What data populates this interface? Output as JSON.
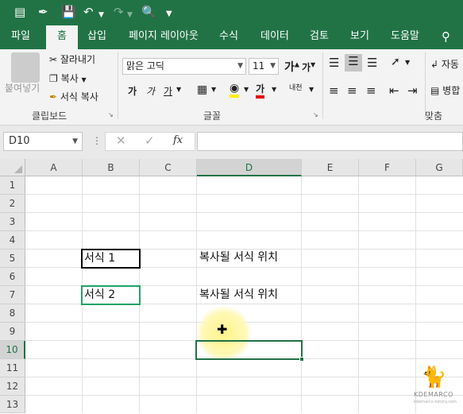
{
  "qat": {
    "icons": [
      "sheet-icon",
      "format-painter-icon",
      "save-icon",
      "undo-icon",
      "redo-icon",
      "print-preview-icon",
      "customize-icon"
    ]
  },
  "tabs": [
    "파일",
    "홈",
    "삽입",
    "페이지 레이아웃",
    "수식",
    "데이터",
    "검토",
    "보기",
    "도움말"
  ],
  "active_tab": "홈",
  "ribbon": {
    "clipboard": {
      "paste": "붙여넣기",
      "cut": "잘라내기",
      "copy": "복사",
      "format_painter": "서식 복사",
      "group_label": "클립보드"
    },
    "font": {
      "font_name": "맑은 고딕",
      "font_size": "11",
      "grow": "가",
      "shrink": "가",
      "bold": "가",
      "italic": "가",
      "underline": "가",
      "font_color": "가",
      "phonetic": "내천",
      "group_label": "글꼴"
    },
    "alignment": {
      "wrap": "자동",
      "merge": "병합",
      "group_label": "맞춤"
    }
  },
  "formula_bar": {
    "name_box": "D10",
    "fx": "fx",
    "content": ""
  },
  "grid": {
    "columns": [
      "A",
      "B",
      "C",
      "D",
      "E",
      "F",
      "G"
    ],
    "selected_column": "D",
    "rows": [
      "1",
      "2",
      "3",
      "4",
      "5",
      "6",
      "7",
      "8",
      "9",
      "10",
      "11",
      "12",
      "13"
    ],
    "selected_row": "10",
    "cells": {
      "B5": "서식 1",
      "B7": "서식 2",
      "D5": "복사될 서식 위치",
      "D7": "복사될 서식 위치"
    }
  },
  "watermark": {
    "brand": "KDEMARCO",
    "url": "kdemarco.tistory.com"
  },
  "colors": {
    "accent": "#217346",
    "format1_border": "#000000",
    "format2_border": "#21a366",
    "cursor_highlight": "#fff48a"
  }
}
